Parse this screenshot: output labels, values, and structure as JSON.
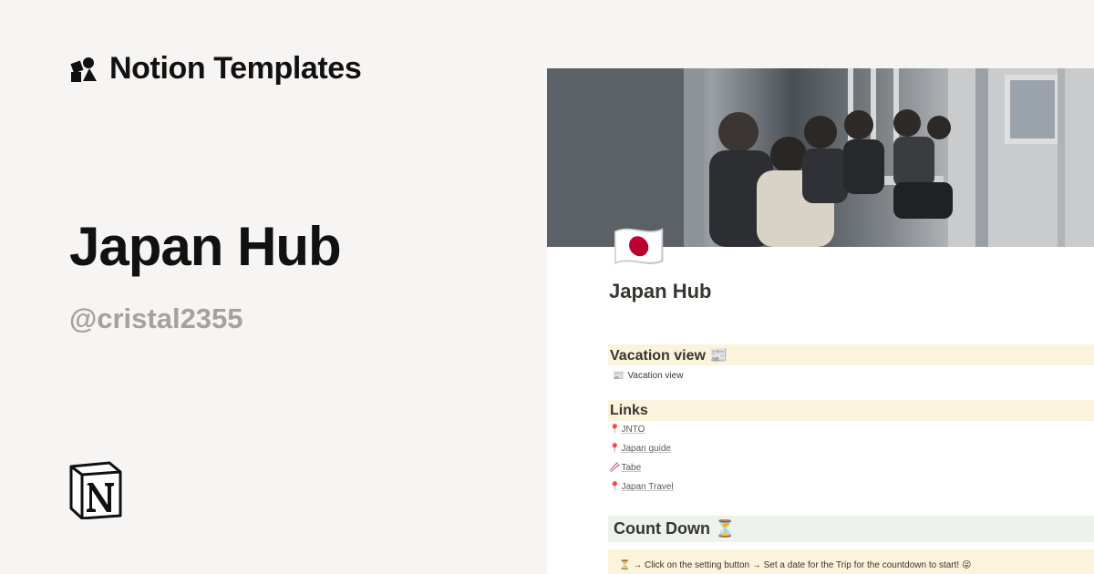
{
  "brand": {
    "name": "Notion Templates"
  },
  "hero": {
    "title": "Japan Hub",
    "handle": "@cristal2355"
  },
  "page": {
    "icon": "🇯🇵",
    "title": "Japan Hub",
    "vacation": {
      "heading": "Vacation view 📰",
      "db_label": "Vacation view",
      "db_icon": "📰"
    },
    "links": {
      "heading": "Links",
      "items": [
        {
          "icon": "📍",
          "label": "JNTO"
        },
        {
          "icon": "📍",
          "label": "Japan guide"
        },
        {
          "icon": "🥢",
          "label": "Tabe"
        },
        {
          "icon": "📍",
          "label": "Japan Travel"
        }
      ]
    },
    "countdown": {
      "heading": "Count Down ⏳",
      "tip": "⏳ → Click on the setting button → Set a date for the Trip for the countdown to start! 😜"
    }
  },
  "colors": {
    "background": "#f6f5f4",
    "callout_yellow": "#fbf3db",
    "callout_green": "#edf3ec",
    "handle_gray": "#a3a29e"
  },
  "icons": {
    "brand": "shapes-logo-icon",
    "footer": "notion-logo-icon"
  }
}
